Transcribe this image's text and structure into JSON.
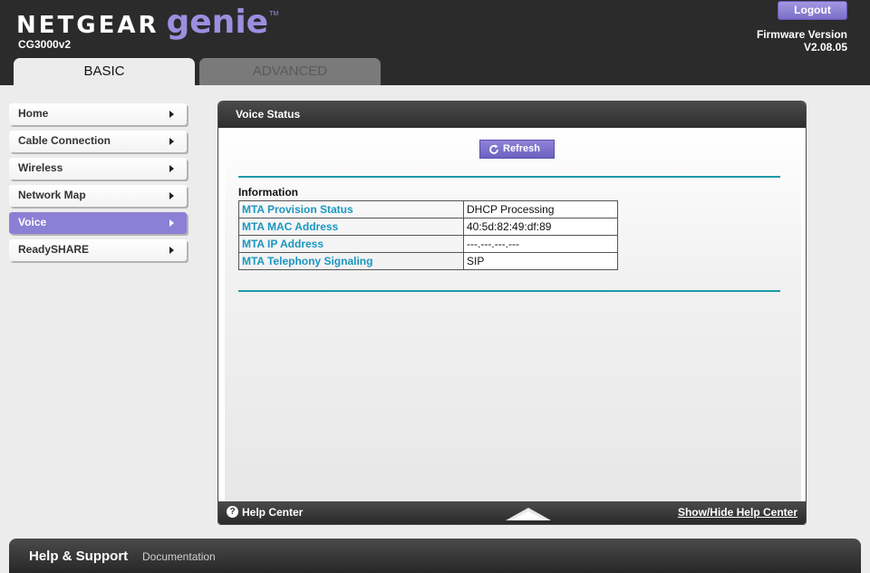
{
  "header": {
    "brand": "NETGEAR",
    "product": "genie",
    "trademark": "TM",
    "model": "CG3000v2",
    "logout_label": "Logout",
    "firmware_label": "Firmware Version",
    "firmware_value": "V2.08.05"
  },
  "tabs": [
    {
      "label": "BASIC",
      "active": true
    },
    {
      "label": "ADVANCED",
      "active": false
    }
  ],
  "sidebar": {
    "items": [
      {
        "label": "Home"
      },
      {
        "label": "Cable Connection"
      },
      {
        "label": "Wireless"
      },
      {
        "label": "Network Map"
      },
      {
        "label": "Voice",
        "active": true
      },
      {
        "label": "ReadySHARE"
      }
    ]
  },
  "panel": {
    "title": "Voice Status",
    "refresh_label": "Refresh",
    "section_label": "Information",
    "rows": [
      {
        "key": "MTA Provision Status",
        "value": "DHCP Processing"
      },
      {
        "key": "MTA MAC Address",
        "value": "40:5d:82:49:df:89"
      },
      {
        "key": "MTA IP Address",
        "value": "---.---.---.---"
      },
      {
        "key": "MTA Telephony Signaling",
        "value": "SIP"
      }
    ],
    "footer": {
      "help_icon": "?",
      "help_center": "Help Center",
      "show_hide": "Show/Hide Help Center"
    }
  },
  "bottom_bar": {
    "help_support": "Help & Support",
    "documentation": "Documentation"
  },
  "colors": {
    "accent_purple": "#8c80d6",
    "link_blue": "#1a97c1",
    "divider_teal": "#1b9aaa",
    "header_bg": "#2b2b2b"
  }
}
